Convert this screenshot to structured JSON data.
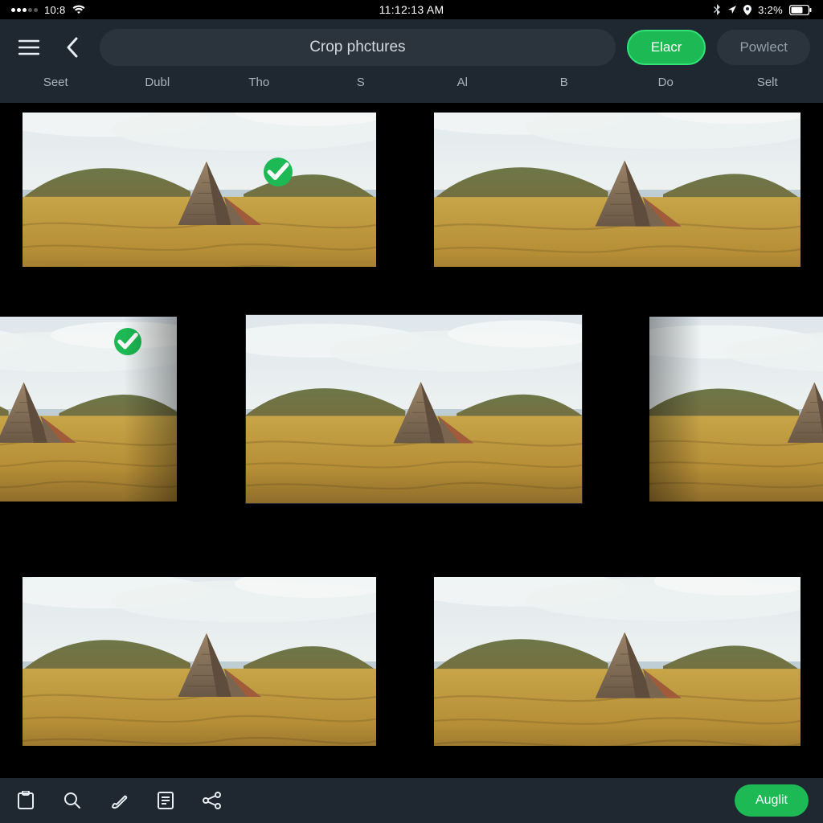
{
  "status": {
    "left_text": "10:8",
    "center_text": "11:12:13 AM",
    "right_text": "3:2%"
  },
  "header": {
    "search_label": "Crop phctures",
    "primary_label": "Elacr",
    "secondary_label": "Powlect"
  },
  "tabs": {
    "items": [
      {
        "label": "Seet"
      },
      {
        "label": "Dubl"
      },
      {
        "label": "Tho"
      },
      {
        "label": "S"
      },
      {
        "label": "Al"
      },
      {
        "label": "B"
      },
      {
        "label": "Do"
      },
      {
        "label": "Selt"
      }
    ]
  },
  "bottom": {
    "action_label": "Auglit"
  },
  "colors": {
    "accent": "#1db954",
    "panel": "#1f2730",
    "pill": "#2b343c"
  }
}
